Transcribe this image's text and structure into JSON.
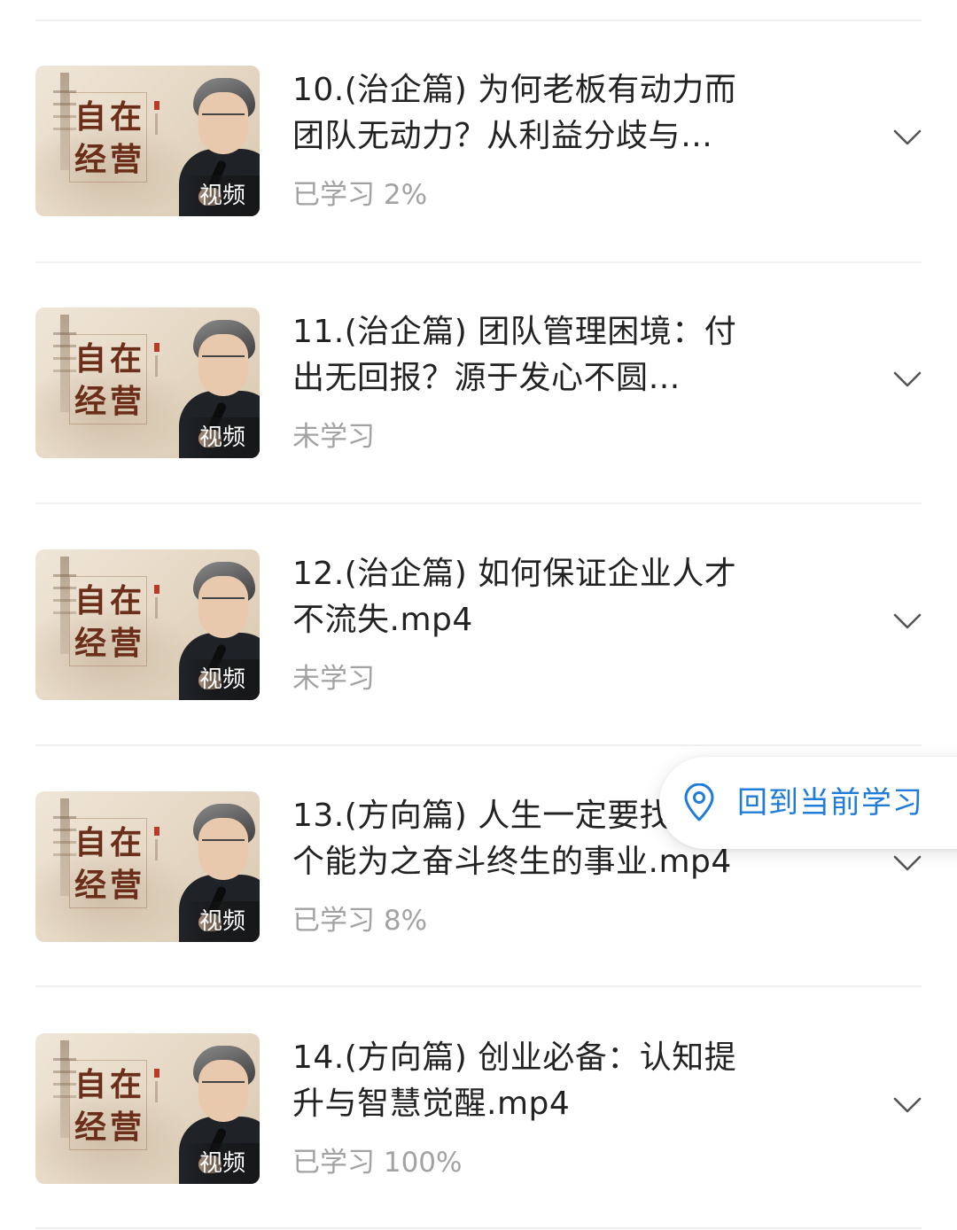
{
  "colors": {
    "accent": "#1f7cd9",
    "title_text": "#222222",
    "status_text": "#a2a2a2",
    "divider": "#efefef"
  },
  "course_items": [
    {
      "thumbnail_title": [
        "自",
        "在",
        "经",
        "营"
      ],
      "badge": "视频",
      "title_line1": "10.(治企篇) 为何老板有动力而",
      "title_line2": "团队无动力？从利益分歧与…",
      "status": "已学习 2%",
      "progress_percent": 2,
      "expand_icon": "chevron-down-icon"
    },
    {
      "thumbnail_title": [
        "自",
        "在",
        "经",
        "营"
      ],
      "badge": "视频",
      "title_line1": "11.(治企篇) 团队管理困境：付",
      "title_line2": "出无回报？源于发心不圆…",
      "status": "未学习",
      "progress_percent": 0,
      "expand_icon": "chevron-down-icon"
    },
    {
      "thumbnail_title": [
        "自",
        "在",
        "经",
        "营"
      ],
      "badge": "视频",
      "title_line1": "12.(治企篇) 如何保证企业人才",
      "title_line2": "不流失.mp4",
      "status": "未学习",
      "progress_percent": 0,
      "expand_icon": "chevron-down-icon"
    },
    {
      "thumbnail_title": [
        "自",
        "在",
        "经",
        "营"
      ],
      "badge": "视频",
      "title_line1": "13.(方向篇) 人生一定要找到一",
      "title_line2": "个能为之奋斗终生的事业.mp4",
      "status": "已学习 8%",
      "progress_percent": 8,
      "expand_icon": "chevron-down-icon"
    },
    {
      "thumbnail_title": [
        "自",
        "在",
        "经",
        "营"
      ],
      "badge": "视频",
      "title_line1": "14.(方向篇) 创业必备：认知提",
      "title_line2": "升与智慧觉醒.mp4",
      "status": "已学习 100%",
      "progress_percent": 100,
      "expand_icon": "chevron-down-icon"
    }
  ],
  "floating_button": {
    "icon": "location-pin-icon",
    "label": "回到当前学习"
  }
}
